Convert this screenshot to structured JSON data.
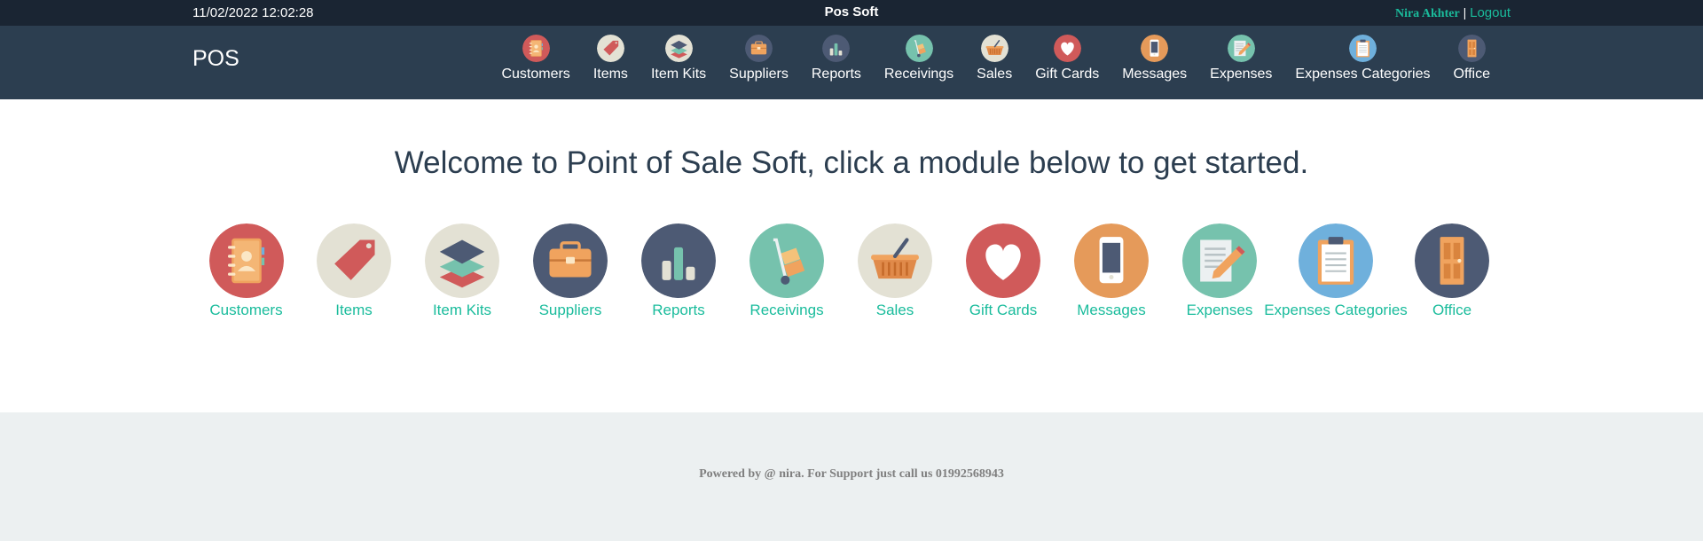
{
  "topbar": {
    "datetime": "11/02/2022 12:02:28",
    "brand": "Pos Soft",
    "user_name": "Nira Akhter",
    "separator": "|",
    "logout_label": "Logout"
  },
  "navbar": {
    "logo": "POS",
    "items": [
      {
        "label": "Customers",
        "icon": "address-book-icon"
      },
      {
        "label": "Items",
        "icon": "tag-icon"
      },
      {
        "label": "Item Kits",
        "icon": "layers-icon"
      },
      {
        "label": "Suppliers",
        "icon": "briefcase-icon"
      },
      {
        "label": "Reports",
        "icon": "bar-chart-icon"
      },
      {
        "label": "Receivings",
        "icon": "hand-truck-icon"
      },
      {
        "label": "Sales",
        "icon": "basket-icon"
      },
      {
        "label": "Gift Cards",
        "icon": "heart-icon"
      },
      {
        "label": "Messages",
        "icon": "phone-icon"
      },
      {
        "label": "Expenses",
        "icon": "pencil-paper-icon"
      },
      {
        "label": "Expenses Categories",
        "icon": "clipboard-icon"
      },
      {
        "label": "Office",
        "icon": "door-icon"
      }
    ]
  },
  "welcome": "Welcome to Point of Sale Soft, click a module below to get started.",
  "modules": [
    {
      "label": "Customers",
      "icon": "address-book-icon",
      "bg": "#d05a5a"
    },
    {
      "label": "Items",
      "icon": "tag-icon",
      "bg": "#e3e1d4"
    },
    {
      "label": "Item Kits",
      "icon": "layers-icon",
      "bg": "#e3e1d4"
    },
    {
      "label": "Suppliers",
      "icon": "briefcase-icon",
      "bg": "#4d5a74"
    },
    {
      "label": "Reports",
      "icon": "bar-chart-icon",
      "bg": "#4d5a74"
    },
    {
      "label": "Receivings",
      "icon": "hand-truck-icon",
      "bg": "#76c2ad"
    },
    {
      "label": "Sales",
      "icon": "basket-icon",
      "bg": "#e3e1d4"
    },
    {
      "label": "Gift Cards",
      "icon": "heart-icon",
      "bg": "#d05a5a"
    },
    {
      "label": "Messages",
      "icon": "phone-icon",
      "bg": "#e59a5a"
    },
    {
      "label": "Expenses",
      "icon": "pencil-paper-icon",
      "bg": "#76c2ad"
    },
    {
      "label": "Expenses Categories",
      "icon": "clipboard-icon",
      "bg": "#6fb0dc"
    },
    {
      "label": "Office",
      "icon": "door-icon",
      "bg": "#4d5a74"
    }
  ],
  "footer": {
    "credit": "Powered by @ nira. For Support just call us 01992568943"
  }
}
